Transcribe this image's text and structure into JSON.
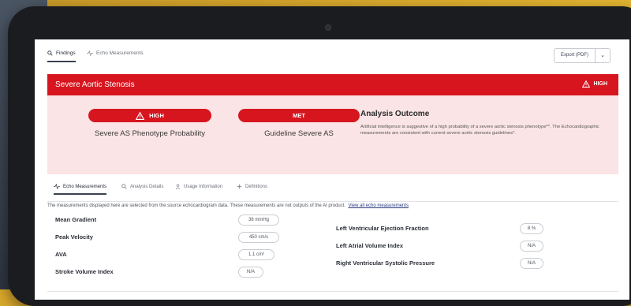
{
  "nav": {
    "tabs": [
      {
        "label": "Findings",
        "icon": "search-icon",
        "active": true
      },
      {
        "label": "Echo Measurements",
        "icon": "pulse-icon",
        "active": false
      }
    ],
    "export_label": "Export (PDF)"
  },
  "banner": {
    "title": "Severe Aortic Stenosis",
    "badge": "HIGH",
    "color": "#d7151f"
  },
  "findings": {
    "probability_badge": "HIGH",
    "probability_label": "Severe AS Phenotype Probability",
    "guideline_badge": "MET",
    "guideline_label": "Guideline Severe AS",
    "outcome_title": "Analysis Outcome",
    "outcome_text": "Artificial intelligence is suggestive of a high probability of a severe aortic stenosis phenotype**. The Echocardiographic measurements are consistent with current severe aortic stenosis guidelines*."
  },
  "subtabs": [
    {
      "label": "Echo Measurements",
      "icon": "pulse-icon",
      "active": true
    },
    {
      "label": "Analysis Details",
      "icon": "search-icon",
      "active": false
    },
    {
      "label": "Usage Information",
      "icon": "person-icon",
      "active": false
    },
    {
      "label": "Definitions",
      "icon": "sparkle-icon",
      "active": false
    }
  ],
  "note": {
    "text": "The measurements displayed here are selected from the source echocardiogram data. These measurements are not outputs of the AI product.",
    "link": "View all echo measurements"
  },
  "measurements": {
    "left": [
      {
        "label": "Mean Gradient",
        "value": "38 mmHg"
      },
      {
        "label": "Peak Velocity",
        "value": "450 cm/s"
      },
      {
        "label": "AVA",
        "value": "1.1 cm²"
      },
      {
        "label": "Stroke Volume Index",
        "value": "N/A"
      }
    ],
    "right": [
      {
        "label": "Left Ventricular Ejection Fraction",
        "value": "8 %"
      },
      {
        "label": "Left Atrial Volume Index",
        "value": "N/A"
      },
      {
        "label": "Right Ventricular Systolic Pressure",
        "value": "N/A"
      }
    ]
  }
}
